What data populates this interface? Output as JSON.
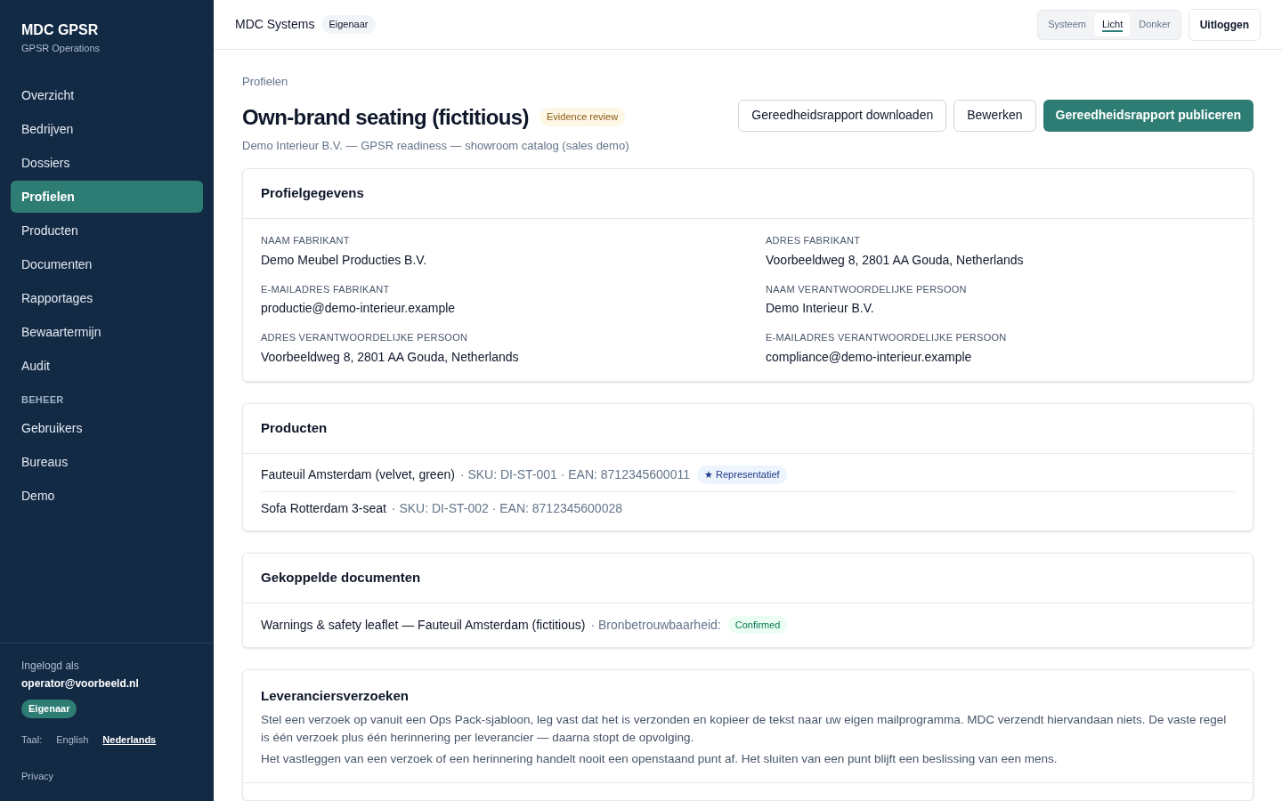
{
  "sidebar": {
    "brand": "MDC GPSR",
    "subtitle": "GPSR Operations",
    "items": [
      {
        "label": "Overzicht",
        "selected": false
      },
      {
        "label": "Bedrijven",
        "selected": false
      },
      {
        "label": "Dossiers",
        "selected": false
      },
      {
        "label": "Profielen",
        "selected": true
      },
      {
        "label": "Producten",
        "selected": false
      },
      {
        "label": "Documenten",
        "selected": false
      },
      {
        "label": "Rapportages",
        "selected": false
      },
      {
        "label": "Bewaartermijn",
        "selected": false
      },
      {
        "label": "Audit",
        "selected": false
      }
    ],
    "section_title": "BEHEER",
    "section_items": [
      {
        "label": "Gebruikers",
        "selected": false
      },
      {
        "label": "Bureaus",
        "selected": false
      },
      {
        "label": "Demo",
        "selected": false
      }
    ],
    "footer": {
      "logged_in_label": "Ingelogd als",
      "email": "operator@voorbeeld.nl",
      "role": "Eigenaar",
      "language_label": "Taal:",
      "languages": [
        {
          "label": "English",
          "selected": false
        },
        {
          "label": "Nederlands",
          "selected": true
        }
      ],
      "privacy": "Privacy"
    }
  },
  "header": {
    "org": "MDC Systems",
    "role": "Eigenaar",
    "theme_options": [
      {
        "label": "Systeem",
        "selected": false
      },
      {
        "label": "Licht",
        "selected": true
      },
      {
        "label": "Donker",
        "selected": false
      }
    ],
    "logout": "Uitloggen"
  },
  "page": {
    "breadcrumb": "Profielen",
    "title": "Own-brand seating (fictitious)",
    "status": "Evidence review",
    "subtitle": "Demo Interieur B.V. — GPSR readiness — showroom catalog (sales demo)",
    "actions": [
      {
        "label": "Gereedheidsrapport downloaden",
        "kind": "secondary"
      },
      {
        "label": "Bewerken",
        "kind": "secondary"
      },
      {
        "label": "Gereedheidsrapport publiceren",
        "kind": "primary"
      }
    ]
  },
  "profile": {
    "title": "Profielgegevens",
    "fields": [
      {
        "label": "NAAM FABRIKANT",
        "value": "Demo Meubel Producties B.V."
      },
      {
        "label": "ADRES FABRIKANT",
        "value": "Voorbeeldweg 8, 2801 AA Gouda, Netherlands"
      },
      {
        "label": "E-MAILADRES FABRIKANT",
        "value": "productie@demo-interieur.example"
      },
      {
        "label": "NAAM VERANTWOORDELIJKE PERSOON",
        "value": "Demo Interieur B.V."
      },
      {
        "label": "ADRES VERANTWOORDELIJKE PERSOON",
        "value": "Voorbeeldweg 8, 2801 AA Gouda, Netherlands"
      },
      {
        "label": "E-MAILADRES VERANTWOORDELIJKE PERSOON",
        "value": "compliance@demo-interieur.example"
      }
    ]
  },
  "products": {
    "title": "Producten",
    "rows": [
      {
        "name": "Fauteuil Amsterdam (velvet, green)",
        "meta": "· SKU: DI-ST-001 · EAN: 8712345600011",
        "badge": "★ Representatief"
      },
      {
        "name": "Sofa Rotterdam 3-seat",
        "meta": "· SKU: DI-ST-002 · EAN: 8712345600028"
      }
    ]
  },
  "documents": {
    "title": "Gekoppelde documenten",
    "rows": [
      {
        "name": "Warnings & safety leaflet — Fauteuil Amsterdam (fictitious)",
        "meta": "· Bronbetrouwbaarheid:",
        "badge": "Confirmed"
      }
    ]
  },
  "supplier_requests": {
    "title": "Leveranciersverzoeken",
    "paragraphs": [
      "Stel een verzoek op vanuit een Ops Pack-sjabloon, leg vast dat het is verzonden en kopieer de tekst naar uw eigen mailprogramma. MDC verzendt hiervandaan niets. De vaste regel is één verzoek plus één herinnering per leverancier — daarna stopt de opvolging.",
      "Het vastleggen van een verzoek of een herinnering handelt nooit een openstaand punt af. Het sluiten van een punt blijft een beslissing van een mens."
    ]
  }
}
